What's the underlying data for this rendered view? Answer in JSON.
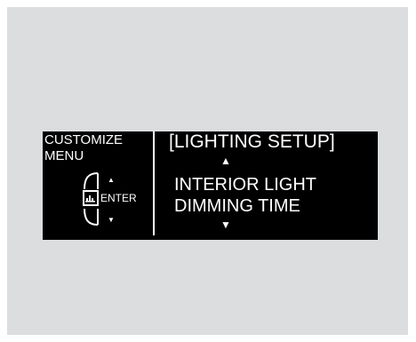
{
  "left_panel": {
    "menu_line1": "CUSTOMIZE",
    "menu_line2": "MENU",
    "enter_label": "ENTER",
    "up_arrow": "▲",
    "down_arrow": "▼"
  },
  "right_panel": {
    "title": "[LIGHTING SETUP]",
    "item_line1": "INTERIOR LIGHT",
    "item_line2": "DIMMING TIME",
    "up_arrow": "▲",
    "down_arrow": "▼"
  },
  "icons": {
    "selector_knob": "selector-knob-icon"
  },
  "colors": {
    "background": "#dcdddf",
    "display": "#000000",
    "text": "#ffffff"
  }
}
